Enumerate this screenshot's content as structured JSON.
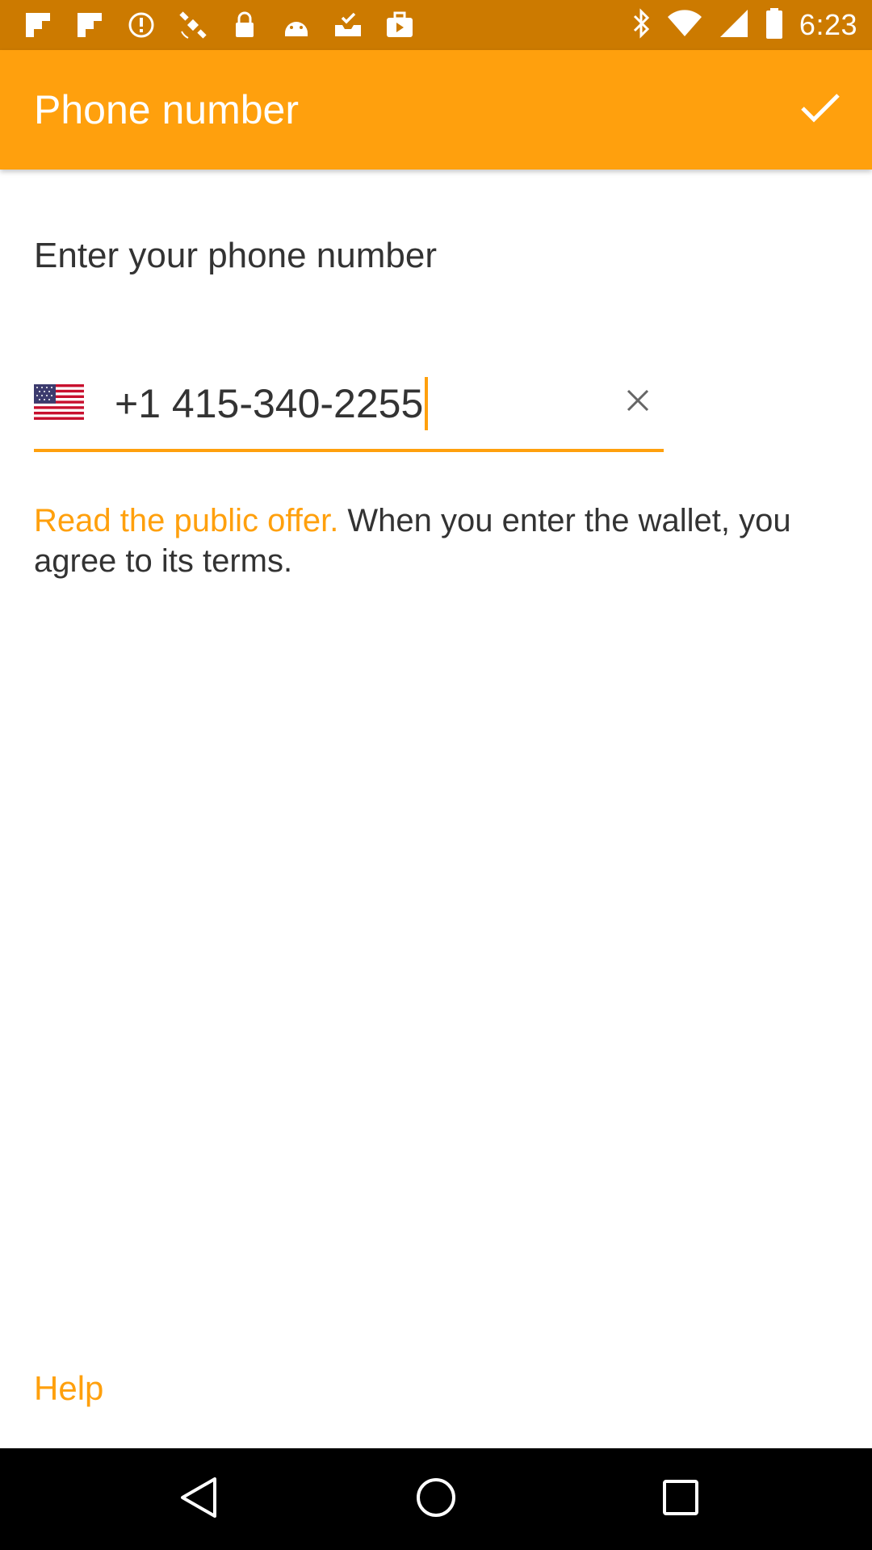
{
  "status_bar": {
    "time": "6:23",
    "left_icons": [
      "flipboard-icon",
      "flipboard-icon",
      "info-icon",
      "satellite-icon",
      "lock-icon",
      "android-icon",
      "inbox-check-icon",
      "briefcase-icon"
    ],
    "right_icons": [
      "bluetooth-icon",
      "wifi-icon",
      "signal-icon",
      "battery-icon"
    ]
  },
  "app_bar": {
    "title": "Phone number",
    "confirm_icon": "check-icon"
  },
  "form": {
    "prompt": "Enter your phone number",
    "country_flag": "us-flag-icon",
    "phone_value": "+1 415-340-2255",
    "clear_icon": "close-icon"
  },
  "offer": {
    "link_text": "Read the public offer.",
    "rest_text": " When you enter the wallet, you agree to its terms."
  },
  "footer": {
    "help_label": "Help"
  },
  "nav_bar": {
    "back_icon": "back-triangle-icon",
    "home_icon": "home-circle-icon",
    "recents_icon": "recents-square-icon"
  },
  "colors": {
    "status_bar": "#cc7a00",
    "app_bar": "#ffa00d",
    "accent": "#ffa00d",
    "text": "#333333",
    "nav_bar": "#000000"
  }
}
